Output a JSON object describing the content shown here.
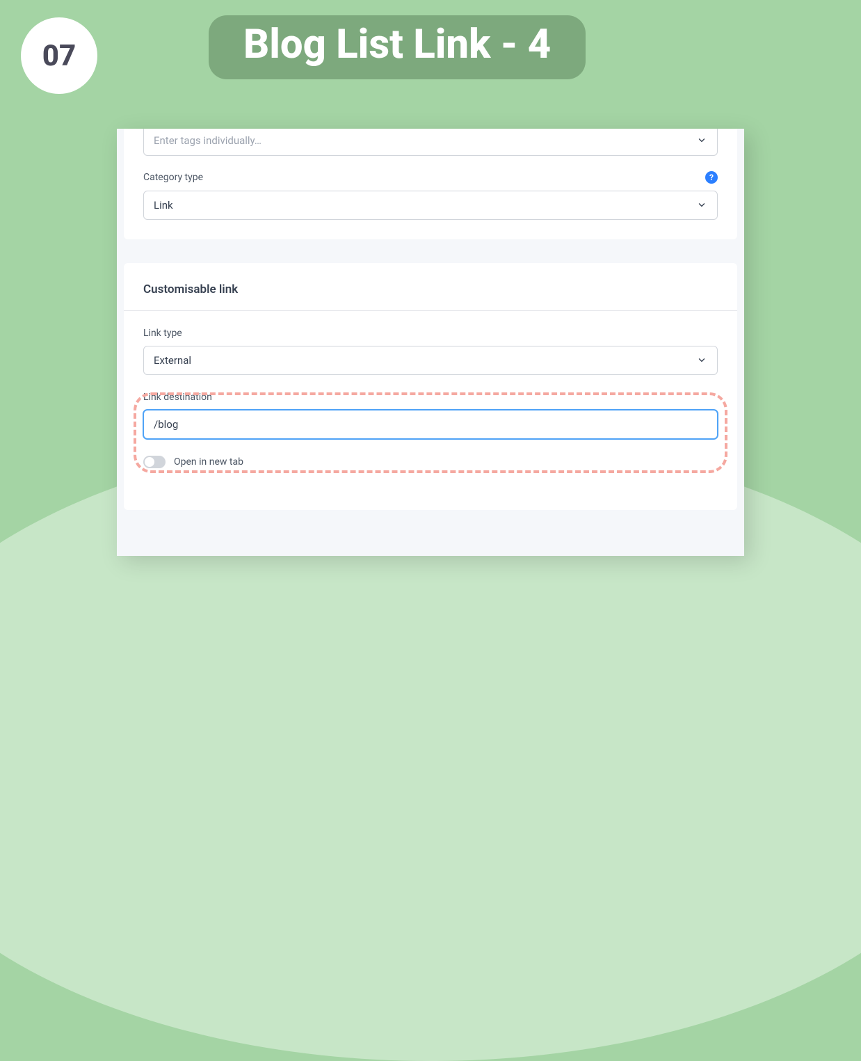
{
  "step_number": "07",
  "page_title": "Blog List Link - 4",
  "top_card": {
    "tags_placeholder": "Enter tags individually…",
    "category_type_label": "Category type",
    "category_type_value": "Link"
  },
  "link_card": {
    "section_title": "Customisable link",
    "link_type_label": "Link type",
    "link_type_value": "External",
    "link_destination_label": "Link destination",
    "link_destination_value": "/blog",
    "open_new_tab_label": "Open in new tab"
  }
}
